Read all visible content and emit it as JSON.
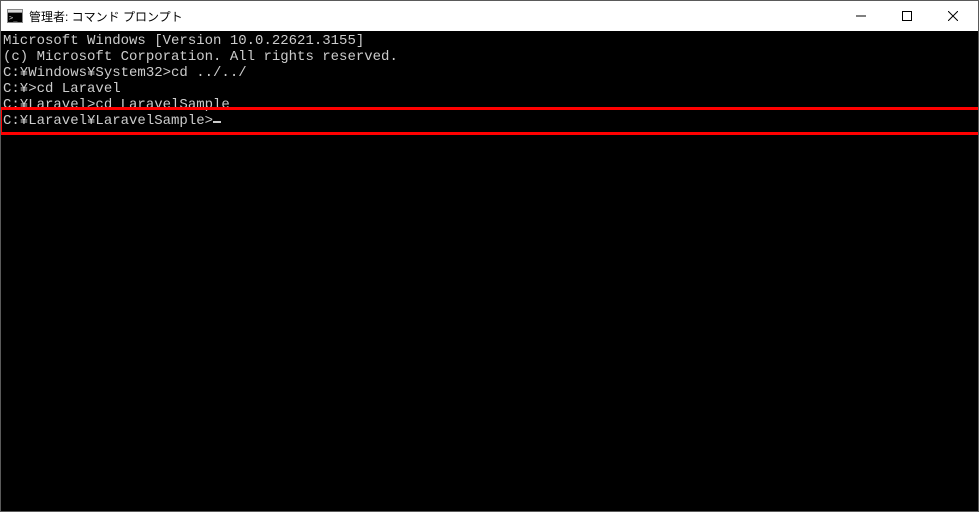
{
  "titlebar": {
    "icon_name": "cmd-icon",
    "title": "管理者: コマンド プロンプト"
  },
  "terminal": {
    "lines": [
      "Microsoft Windows [Version 10.0.22621.3155]",
      "(c) Microsoft Corporation. All rights reserved.",
      "",
      "C:¥Windows¥System32>cd ../../",
      "",
      "C:¥>cd Laravel",
      "",
      "C:¥Laravel>cd LaravelSample",
      "",
      "C:¥Laravel¥LaravelSample>"
    ],
    "highlight_line_index": 9
  },
  "colors": {
    "window_bg": "#000000",
    "text": "#cccccc",
    "highlight_border": "#ff0000"
  }
}
